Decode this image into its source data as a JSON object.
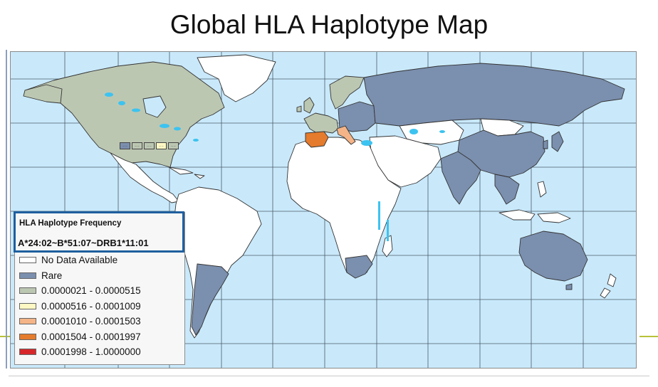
{
  "slide": {
    "title": "Global HLA Haplotype Map"
  },
  "legend": {
    "title": "HLA Haplotype Frequency",
    "haplotype": "A*24:02~B*51:07~DRB1*11:01",
    "items": [
      {
        "label": "No Data Available",
        "color": "#ffffff"
      },
      {
        "label": "Rare",
        "color": "#7b8fae"
      },
      {
        "label": "0.0000021 - 0.0000515",
        "color": "#bcc7b2"
      },
      {
        "label": "0.0000516 - 0.0001009",
        "color": "#fdf8c4"
      },
      {
        "label": "0.0001010 - 0.0001503",
        "color": "#f4b487"
      },
      {
        "label": "0.0001504 - 0.0001997",
        "color": "#e57b2c"
      },
      {
        "label": "0.0001998 - 1.0000000",
        "color": "#d7262a"
      }
    ]
  },
  "map": {
    "ocean_color": "#c9e9fb",
    "lake_color": "#3cc3f0",
    "regions": [
      {
        "name": "North America",
        "class": "0.0000021 - 0.0000515"
      },
      {
        "name": "Mexico and Central America",
        "class": "No Data Available"
      },
      {
        "name": "South America",
        "class": "No Data Available"
      },
      {
        "name": "Argentina",
        "class": "Rare"
      },
      {
        "name": "Africa",
        "class": "No Data Available"
      },
      {
        "name": "South Africa",
        "class": "Rare"
      },
      {
        "name": "Spain",
        "class": "0.0001504 - 0.0001997"
      },
      {
        "name": "Italy",
        "class": "0.0001010 - 0.0001503"
      },
      {
        "name": "Russia",
        "class": "Rare"
      },
      {
        "name": "China",
        "class": "Rare"
      },
      {
        "name": "India",
        "class": "Rare"
      },
      {
        "name": "Australia",
        "class": "Rare"
      }
    ],
    "inset_labels": [
      "-- --",
      "-- --",
      "-- --",
      "-- --",
      "-- --"
    ]
  }
}
